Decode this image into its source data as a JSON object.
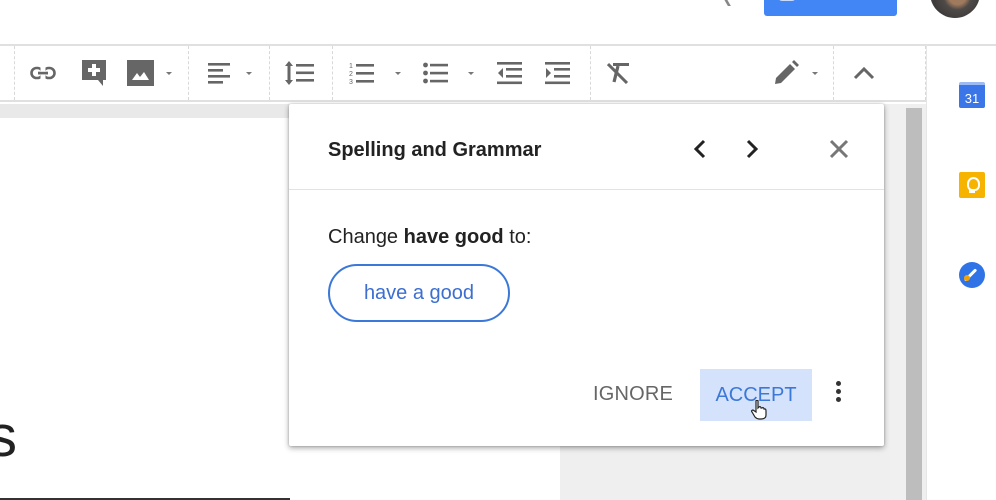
{
  "header": {
    "share_button": {
      "label": "",
      "icon": "lock-icon",
      "color": "#4285f4"
    },
    "avatar": {
      "icon": "user-avatar"
    }
  },
  "toolbar": {
    "items": [
      {
        "name": "insert-link",
        "icon": "link-icon"
      },
      {
        "name": "add-comment",
        "icon": "add-comment-icon"
      },
      {
        "name": "insert-image",
        "icon": "image-icon",
        "dropdown": true
      },
      {
        "name": "align",
        "icon": "align-left-icon",
        "dropdown": true
      },
      {
        "name": "line-spacing",
        "icon": "line-spacing-icon"
      },
      {
        "name": "numbered-list",
        "icon": "numbered-list-icon",
        "dropdown": true
      },
      {
        "name": "bulleted-list",
        "icon": "bulleted-list-icon",
        "dropdown": true
      },
      {
        "name": "decrease-indent",
        "icon": "decrease-indent-icon"
      },
      {
        "name": "increase-indent",
        "icon": "increase-indent-icon"
      },
      {
        "name": "clear-formatting",
        "icon": "clear-formatting-icon"
      },
      {
        "name": "editing-mode",
        "icon": "pencil-icon",
        "dropdown": true
      },
      {
        "name": "collapse-toolbar",
        "icon": "chevron-up-icon"
      }
    ]
  },
  "document": {
    "visible_glyph": "s"
  },
  "side_panel": {
    "items": [
      {
        "name": "calendar",
        "icon": "calendar-icon",
        "text": "31"
      },
      {
        "name": "keep",
        "icon": "keep-icon"
      },
      {
        "name": "tasks",
        "icon": "tasks-icon"
      }
    ]
  },
  "dialog": {
    "title": "Spelling and Grammar",
    "prev_label": "‹",
    "next_label": "›",
    "close_label": "×",
    "message_prefix": "Change ",
    "message_term": "have good",
    "message_suffix": " to:",
    "suggestion": "have a good",
    "ignore_label": "IGNORE",
    "accept_label": "ACCEPT",
    "accent_color": "#3c78d8"
  }
}
